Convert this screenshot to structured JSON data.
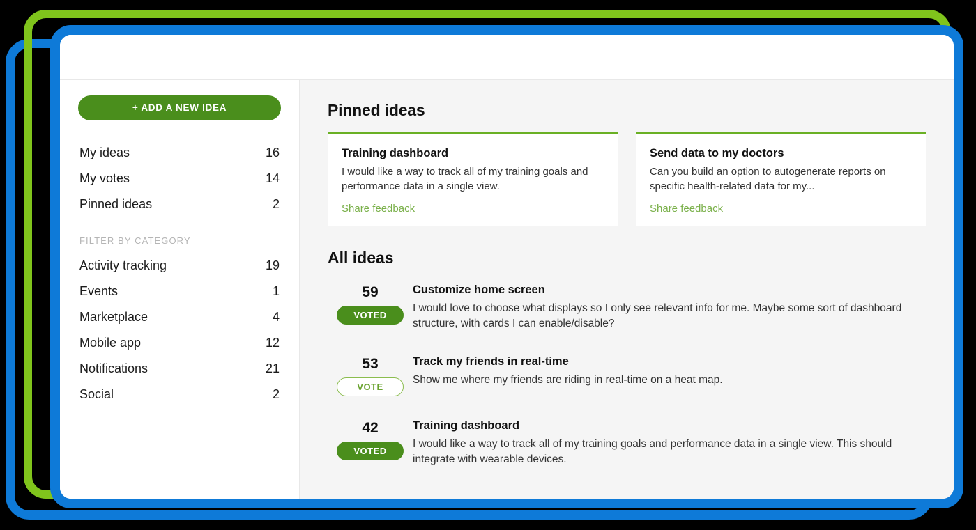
{
  "frames": {
    "outer_blue": "#0e7ad8",
    "green": "#80c41c",
    "main_blue": "#0e7ad8",
    "background": "#000000"
  },
  "theme": {
    "primary_green": "#4a8e1c",
    "accent_green": "#6ab024",
    "link_green": "#7ab04a",
    "panel_bg": "#f5f5f5"
  },
  "sidebar": {
    "add_idea_label": "+ ADD A NEW IDEA",
    "nav": [
      {
        "label": "My ideas",
        "count": "16"
      },
      {
        "label": "My votes",
        "count": "14"
      },
      {
        "label": "Pinned ideas",
        "count": "2"
      }
    ],
    "filter_heading": "FILTER BY CATEGORY",
    "categories": [
      {
        "label": "Activity tracking",
        "count": "19"
      },
      {
        "label": "Events",
        "count": "1"
      },
      {
        "label": "Marketplace",
        "count": "4"
      },
      {
        "label": "Mobile app",
        "count": "12"
      },
      {
        "label": "Notifications",
        "count": "21"
      },
      {
        "label": "Social",
        "count": "2"
      }
    ]
  },
  "main": {
    "pinned_title": "Pinned ideas",
    "pinned_cards": [
      {
        "title": "Training dashboard",
        "desc": "I would like a way to track all of my training goals and performance data in a single view.",
        "link": "Share feedback"
      },
      {
        "title": "Send data to my doctors",
        "desc": "Can you build an option to autogenerate reports on specific health-related data for my...",
        "link": "Share feedback"
      }
    ],
    "all_ideas_title": "All ideas",
    "ideas": [
      {
        "count": "59",
        "vote_label": "VOTED",
        "voted": true,
        "title": "Customize home screen",
        "desc": "I would love to choose what displays so I only see relevant info for me. Maybe some sort of dashboard structure, with cards I can enable/disable?"
      },
      {
        "count": "53",
        "vote_label": "VOTE",
        "voted": false,
        "title": "Track my friends in real-time",
        "desc": "Show me where my friends are riding in real-time on a heat map."
      },
      {
        "count": "42",
        "vote_label": "VOTED",
        "voted": true,
        "title": "Training dashboard",
        "desc": "I would like a way to track all of my training goals and performance data in a single view. This should integrate with wearable devices."
      }
    ]
  }
}
